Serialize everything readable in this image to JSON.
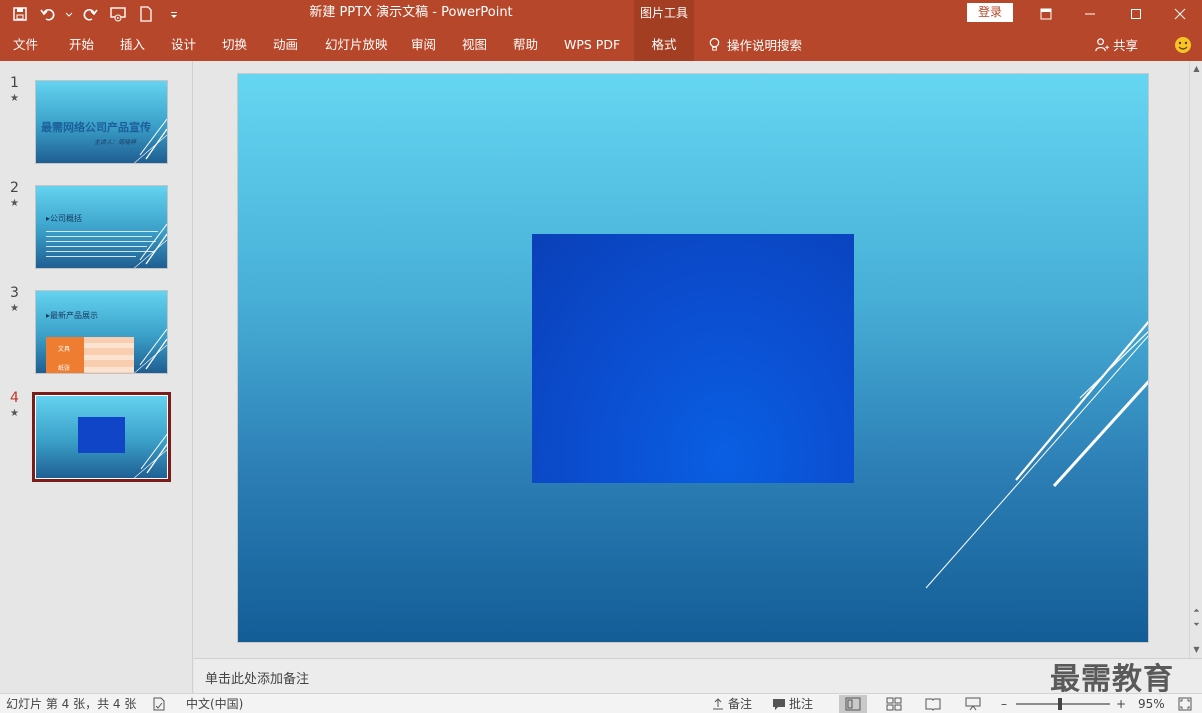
{
  "window": {
    "title": "新建 PPTX 演示文稿  -  PowerPoint",
    "context_tab": "图片工具",
    "login": "登录"
  },
  "ribbon": {
    "tabs": [
      "文件",
      "开始",
      "插入",
      "设计",
      "切换",
      "动画",
      "幻灯片放映",
      "审阅",
      "视图",
      "帮助",
      "WPS PDF",
      "格式"
    ],
    "active_tab": "格式",
    "tell_me": "操作说明搜索",
    "share": "共享"
  },
  "slides": [
    {
      "number": "1",
      "star": "★",
      "title": "最需网络公司产品宣传",
      "subtitle": "主讲人：周晓婷"
    },
    {
      "number": "2",
      "star": "★",
      "heading": "▸公司概括"
    },
    {
      "number": "3",
      "star": "★",
      "heading": "▸最新产品展示",
      "table_labels": [
        "文具",
        "纸张"
      ]
    },
    {
      "number": "4",
      "star": "★"
    }
  ],
  "current_slide": "4",
  "notes_placeholder": "单击此处添加备注",
  "watermark": "最需教育",
  "status": {
    "slide_info": "幻灯片 第 4 张，共 4 张",
    "language": "中文(中国)",
    "notes_btn": "备注",
    "comments_btn": "批注",
    "zoom_minus": "–",
    "zoom_plus": "+",
    "zoom": "95%",
    "zoom_level_percent": 95
  },
  "colors": {
    "accent": "#b7472a",
    "accent_dark": "#a33e22",
    "selected_thumb_border": "#7b1c1c"
  }
}
